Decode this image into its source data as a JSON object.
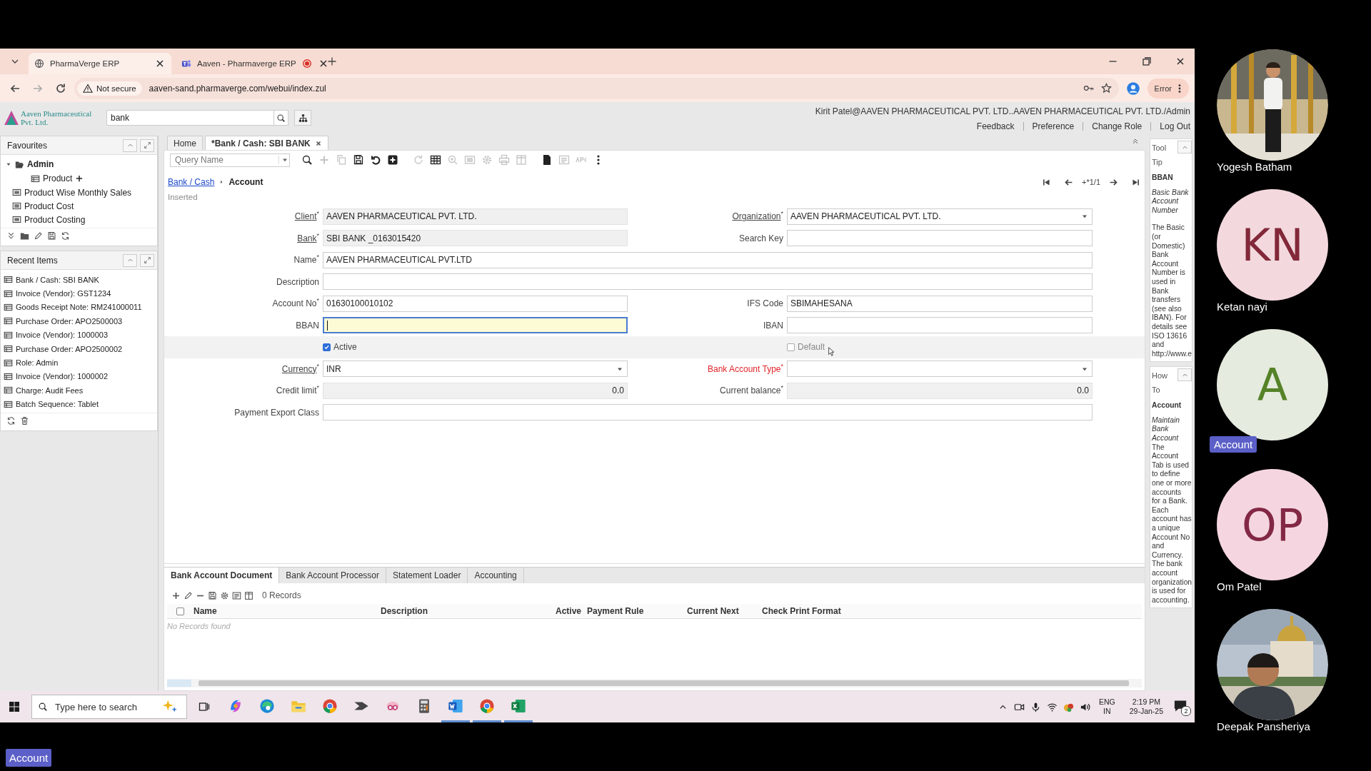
{
  "browser": {
    "tabs": [
      {
        "title": "PharmaVerge ERP",
        "selected": true,
        "recording": false
      },
      {
        "title": "Aaven - Pharmaverge ERP",
        "selected": false,
        "recording": true
      }
    ],
    "security": "Not secure",
    "url": "aaven-sand.pharmaverge.com/webui/index.zul",
    "profile_status": "Error"
  },
  "app": {
    "logo_text": "Aaven Pharmaceutical Pvt. Ltd.",
    "search": {
      "value": "bank"
    },
    "user": "Kirit Patel@AAVEN PHARMACEUTICAL PVT. LTD..AAVEN PHARMACEUTICAL PVT. LTD./Admin",
    "links": [
      "Feedback",
      "Preference",
      "Change Role",
      "Log Out"
    ]
  },
  "favourites": {
    "title": "Favourites",
    "tree": [
      {
        "label": "Admin",
        "kind": "folder",
        "expanded": true,
        "quick_new": false,
        "children": [
          {
            "label": "Product",
            "kind": "window",
            "quick_new": true
          }
        ]
      },
      {
        "label": "Product Wise Monthly Sales",
        "kind": "report",
        "quick_new": false
      },
      {
        "label": "Product Cost",
        "kind": "report",
        "quick_new": false
      },
      {
        "label": "Product Costing",
        "kind": "report",
        "quick_new": false
      }
    ]
  },
  "recent_items": {
    "title": "Recent Items",
    "items": [
      "Bank / Cash: SBI BANK",
      "Invoice (Vendor): GST1234",
      "Goods Receipt Note: RM241000011",
      "Purchase Order: APO2500003",
      "Invoice (Vendor): 1000003",
      "Purchase Order: APO2500002",
      "Role: Admin",
      "Invoice (Vendor): 1000002",
      "Charge: Audit Fees",
      "Batch Sequence: Tablet"
    ]
  },
  "window_tabs": [
    {
      "label": "Home",
      "selected": false,
      "closable": false
    },
    {
      "label": "*Bank / Cash: SBI BANK",
      "selected": true,
      "closable": true
    }
  ],
  "toolbar": {
    "query_placeholder": "Query Name",
    "tools": [
      {
        "kind": "search",
        "disabled": false
      },
      {
        "kind": "plus",
        "disabled": true
      },
      {
        "kind": "copy",
        "disabled": true
      },
      {
        "kind": "save",
        "disabled": false
      },
      {
        "kind": "undo",
        "disabled": false
      },
      {
        "kind": "addbox",
        "disabled": false
      },
      {
        "kind": "refresh",
        "disabled": true
      },
      {
        "kind": "grid",
        "disabled": false
      },
      {
        "kind": "zoom",
        "disabled": true
      },
      {
        "kind": "report",
        "disabled": true
      },
      {
        "kind": "gear",
        "disabled": true
      },
      {
        "kind": "print",
        "disabled": true
      },
      {
        "kind": "panel",
        "disabled": true
      },
      {
        "kind": "doc",
        "disabled": false
      },
      {
        "kind": "list",
        "disabled": true
      },
      {
        "kind": "text",
        "disabled": true
      },
      {
        "kind": "more",
        "disabled": false
      }
    ]
  },
  "breadcrumb": {
    "parent": "Bank / Cash",
    "current": "Account"
  },
  "record_position": "+*1/1",
  "record_status": "Inserted",
  "form": {
    "rows": [
      [
        {
          "label": "Client$^{*}$",
          "kind": "text",
          "value": "AAVEN PHARMACEUTICAL PVT. LTD.",
          "readonly": true,
          "zoomable": true,
          "missing": false,
          "focused": false
        },
        {
          "label": "Organization$^{*}$",
          "kind": "select",
          "value": "AAVEN PHARMACEUTICAL PVT. LTD.",
          "readonly": false,
          "zoomable": true,
          "missing": false,
          "focused": false
        }
      ],
      [
        {
          "label": "Bank$^{*}$",
          "kind": "text",
          "value": "SBI BANK _0163015420",
          "readonly": true,
          "zoomable": true,
          "missing": false,
          "focused": false
        },
        {
          "label": "Search Key",
          "kind": "text",
          "readonly": false,
          "zoomable": false,
          "missing": false,
          "focused": false
        }
      ],
      [
        {
          "label": "Name$^{*}$",
          "kind": "text",
          "value": "AAVEN PHARMACEUTICAL PVT.LTD",
          "readonly": false,
          "zoomable": false,
          "missing": false,
          "focused": false
        }
      ],
      [
        {
          "label": "Description",
          "kind": "text",
          "readonly": false,
          "zoomable": false,
          "missing": false,
          "focused": false
        }
      ],
      [
        {
          "label": "Account No$^{*}$",
          "kind": "text",
          "value": "01630100010102",
          "readonly": false,
          "zoomable": false,
          "missing": false,
          "focused": false
        },
        {
          "label": "IFS Code",
          "kind": "text",
          "value": "SBIMAHESANA",
          "readonly": false,
          "zoomable": false,
          "missing": false,
          "focused": false
        }
      ],
      [
        {
          "label": "BBAN",
          "kind": "text",
          "readonly": false,
          "zoomable": false,
          "missing": false,
          "focused": true
        },
        {
          "label": "IBAN",
          "kind": "text",
          "readonly": false,
          "zoomable": false,
          "missing": false,
          "focused": false
        }
      ],
      [
        {
          "label": "Active",
          "kind": "checkbox",
          "checked": true,
          "readonly": false
        },
        {
          "label": "Default",
          "kind": "checkbox",
          "checked": false,
          "readonly": true
        }
      ],
      [
        {
          "label": "Currency$^{*}$",
          "kind": "select",
          "value": "INR",
          "readonly": false,
          "zoomable": true,
          "missing": false,
          "focused": false
        },
        {
          "label": "Bank Account Type$^{*}$",
          "kind": "select",
          "readonly": false,
          "zoomable": false,
          "missing": true,
          "focused": false
        }
      ],
      [
        {
          "label": "Credit limit$^{*}$",
          "kind": "number",
          "value": "0.0",
          "readonly": true,
          "zoomable": false,
          "missing": false,
          "focused": false
        },
        {
          "label": "Current balance$^{*}$",
          "kind": "number",
          "value": "0.0",
          "readonly": true,
          "zoomable": false,
          "missing": false,
          "focused": false
        }
      ],
      [
        {
          "label": "Payment Export Class",
          "kind": "text",
          "readonly": false,
          "zoomable": false,
          "missing": false,
          "focused": false
        }
      ]
    ]
  },
  "detail": {
    "tabs": [
      {
        "label": "Bank Account Document",
        "selected": true
      },
      {
        "label": "Bank Account Processor",
        "selected": false
      },
      {
        "label": "Statement Loader",
        "selected": false
      },
      {
        "label": "Accounting",
        "selected": false
      }
    ],
    "record_count": "0 Records",
    "select_all_checked": false,
    "columns": [
      "Name",
      "Description",
      "Active",
      "Payment Rule",
      "Current Next",
      "Check Print Format"
    ],
    "empty_text": "No Records found"
  },
  "help": {
    "tooltip": {
      "title": "Tool Tip",
      "field": "BBAN",
      "name": "Basic Bank Account Number",
      "text": "The Basic (or Domestic) Bank Account Number is used in Bank transfers (see also IBAN). For details see ISO 13616 and http://www.e"
    },
    "howto": {
      "title": "How To",
      "heading": "Account",
      "subheading": "Maintain Bank Account",
      "text": "The Account Tab is used to define one or more accounts for a Bank. Each account has a unique Account No and Currency. The bank account organization is used for accounting."
    }
  },
  "taskbar": {
    "search_placeholder": "Type here to search",
    "apps": [
      {
        "kind": "copilot",
        "running": false
      },
      {
        "kind": "edge",
        "running": false
      },
      {
        "kind": "files",
        "running": false
      },
      {
        "kind": "chrome",
        "running": false
      },
      {
        "kind": "arrow",
        "running": false
      },
      {
        "kind": "snip",
        "running": false
      },
      {
        "kind": "calculator",
        "running": false
      },
      {
        "kind": "word",
        "running": true
      },
      {
        "kind": "chrome",
        "running": true
      },
      {
        "kind": "excel",
        "running": true
      }
    ],
    "language": "ENG",
    "region": "IN",
    "time": "2:19 PM",
    "date": "29-Jan-25",
    "notifications": "2"
  },
  "participants": [
    {
      "name": "Yogesh Batham",
      "highlighted": false
    },
    {
      "name": "Ketan nayi",
      "kind": "initials",
      "initials": "KN",
      "color": "#f3d9de",
      "highlighted": false
    },
    {
      "name": "Account",
      "kind": "initials",
      "initials": "A",
      "color": "#e5ebdf",
      "highlighted": true
    },
    {
      "name": "Om Patel",
      "kind": "initials",
      "initials": "OP",
      "color": "#f5d6e0",
      "highlighted": false
    },
    {
      "name": "Deepak Pansheriya",
      "highlighted": false
    }
  ],
  "presenter_label": "Account"
}
